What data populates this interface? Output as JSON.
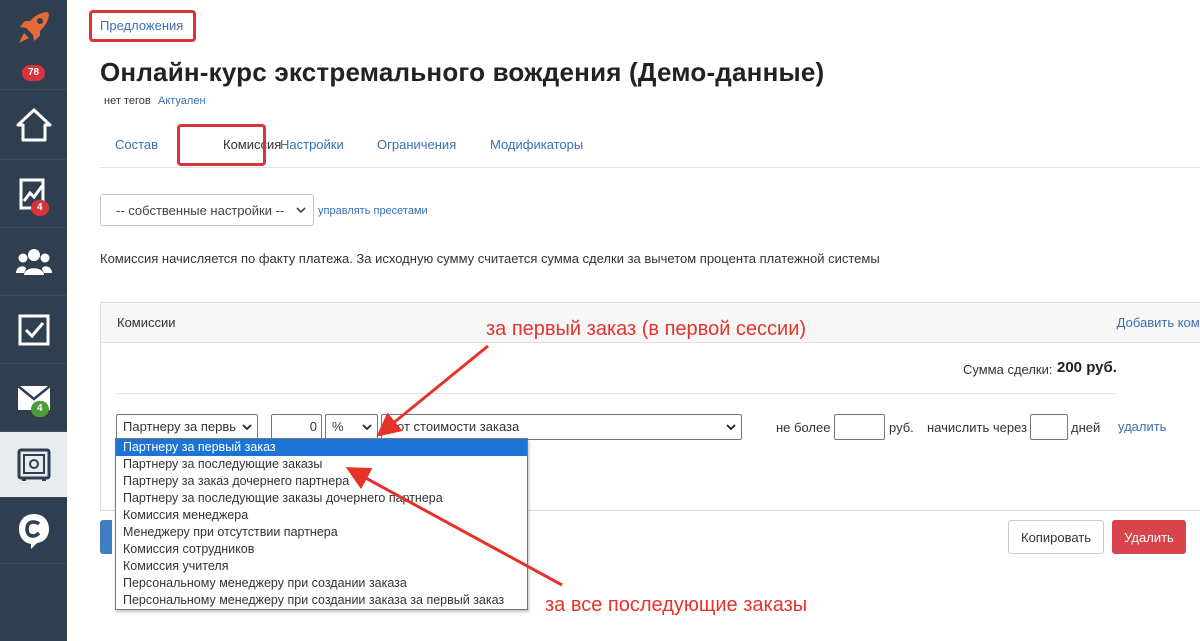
{
  "sidebar": {
    "badges": {
      "top": "78",
      "stats": "4",
      "mail": "4"
    }
  },
  "breadcrumb": {
    "label": "Предложения"
  },
  "page": {
    "title": "Онлайн-курс экстремального вождения (Демо-данные)",
    "tags": "нет тегов",
    "status": "Актуален"
  },
  "tabs": [
    {
      "label": "Состав"
    },
    {
      "label": "Комиссия"
    },
    {
      "label": "Настройки"
    },
    {
      "label": "Ограничения"
    },
    {
      "label": "Модификаторы"
    }
  ],
  "preset": {
    "selected": "-- собственные настройки --",
    "manage_link": "управлять пресетами"
  },
  "note": "Комиссия начисляется по факту платежа. За исходную сумму считается сумма сделки за вычетом процента платежной системы",
  "commissions": {
    "title": "Комиссии",
    "add_link": "Добавить комиссию",
    "sum_label": "Сумма сделки:",
    "sum_value": "200 руб.",
    "row": {
      "type_selected": "Партнеру за первь",
      "amount": "0",
      "unit": "%",
      "base": "от стоимости заказа",
      "max_label": "не более",
      "currency": "руб.",
      "delay_label": "начислить через",
      "days": "дней",
      "delete": "удалить"
    },
    "type_options": [
      "Партнеру за первый заказ",
      "Партнеру за последующие заказы",
      "Партнеру за заказ дочернего партнера",
      "Партнеру за последующие заказы дочернего партнера",
      "Комиссия менеджера",
      "Менеджеру при отсутствии партнера",
      "Комиссия сотрудников",
      "Комиссия учителя",
      "Персональному менеджеру при создании заказа",
      "Персональному менеджеру при создании заказа за первый заказ"
    ]
  },
  "buttons": {
    "copy": "Копировать",
    "delete": "Удалить"
  },
  "annotations": {
    "first": "за первый заказ (в первой сессии)",
    "subsequent": "за все последующие заказы"
  },
  "colors": {
    "sidebar": "#2f3f4f",
    "accent": "#d9343c",
    "link": "#3a6fb0",
    "selected": "#1e74d6"
  }
}
